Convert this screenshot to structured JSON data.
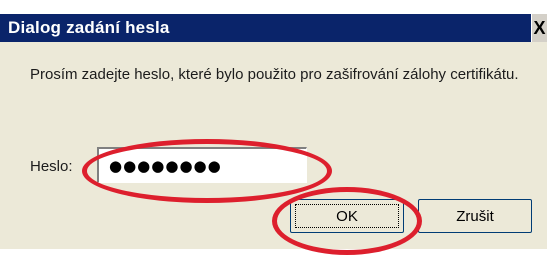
{
  "window": {
    "title": "Dialog zadání hesla",
    "close_label": "X"
  },
  "prompt": "Prosím zadejte heslo, které bylo použito pro zašifrování zálohy certifikátu.",
  "password": {
    "label": "Heslo:",
    "value": "●●●●●●●●"
  },
  "buttons": {
    "ok": "OK",
    "cancel": "Zrušit"
  },
  "colors": {
    "titlebar": "#0a246a",
    "dialog_bg": "#ece9d8",
    "highlight_ring": "#dd1f2d"
  }
}
